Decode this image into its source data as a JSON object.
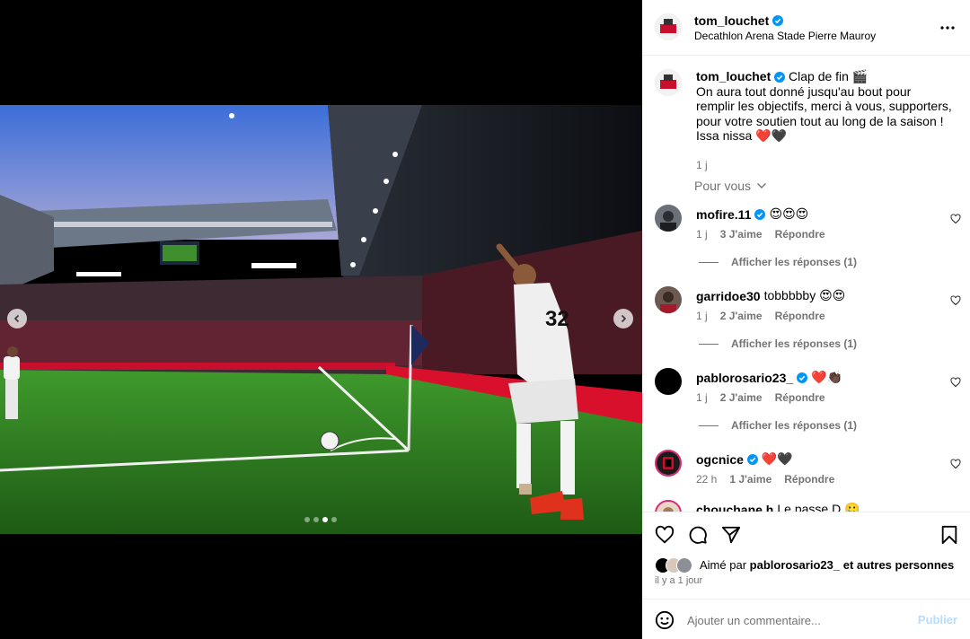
{
  "post": {
    "author": "tom_louchet",
    "location": "Decathlon Arena Stade Pierre Mauroy",
    "verified": true,
    "caption_title": "Clap de fin 🎬",
    "caption_body": "On aura tout donné jusqu'au bout pour remplir les objectifs, merci à vous, supporters, pour votre soutien tout au long de la saison !",
    "caption_sign": "Issa nissa ❤️🖤",
    "caption_time": "1 j"
  },
  "media": {
    "carousel_total": 4,
    "carousel_active_index": 2,
    "icons": {
      "prev": "chevron-left-icon",
      "next": "chevron-right-icon"
    }
  },
  "comments_sort": "Pour vous",
  "comments": [
    {
      "user": "mofire.11",
      "verified": true,
      "text": "😍😍😍",
      "time": "1 j",
      "likes": "3 J'aime",
      "reply": "Répondre",
      "replies": "Afficher les réponses (1)"
    },
    {
      "user": "garridoe30",
      "verified": false,
      "text": "tobbbbby 😍😍",
      "time": "1 j",
      "likes": "2 J'aime",
      "reply": "Répondre",
      "replies": "Afficher les réponses (1)"
    },
    {
      "user": "pablorosario23_",
      "verified": true,
      "text": "❤️👏🏿",
      "time": "1 j",
      "likes": "2 J'aime",
      "reply": "Répondre",
      "replies": "Afficher les réponses (1)"
    },
    {
      "user": "ogcnice",
      "verified": true,
      "text": "❤️🖤",
      "time": "22 h",
      "likes": "1 J'aime",
      "reply": "Répondre"
    },
    {
      "user": "chouchane.h",
      "verified": false,
      "text": "Le passe D 🥲"
    }
  ],
  "likes": {
    "prefix": "Aimé par",
    "user": "pablorosario23_",
    "suffix": "et autres personnes",
    "time": "il y a 1 jour"
  },
  "composer": {
    "placeholder": "Ajouter un commentaire...",
    "publish_label": "Publier"
  },
  "colors": {
    "verified_blue": "#0095f6",
    "muted": "#737373",
    "publish_disabled": "#b9dcfa"
  }
}
